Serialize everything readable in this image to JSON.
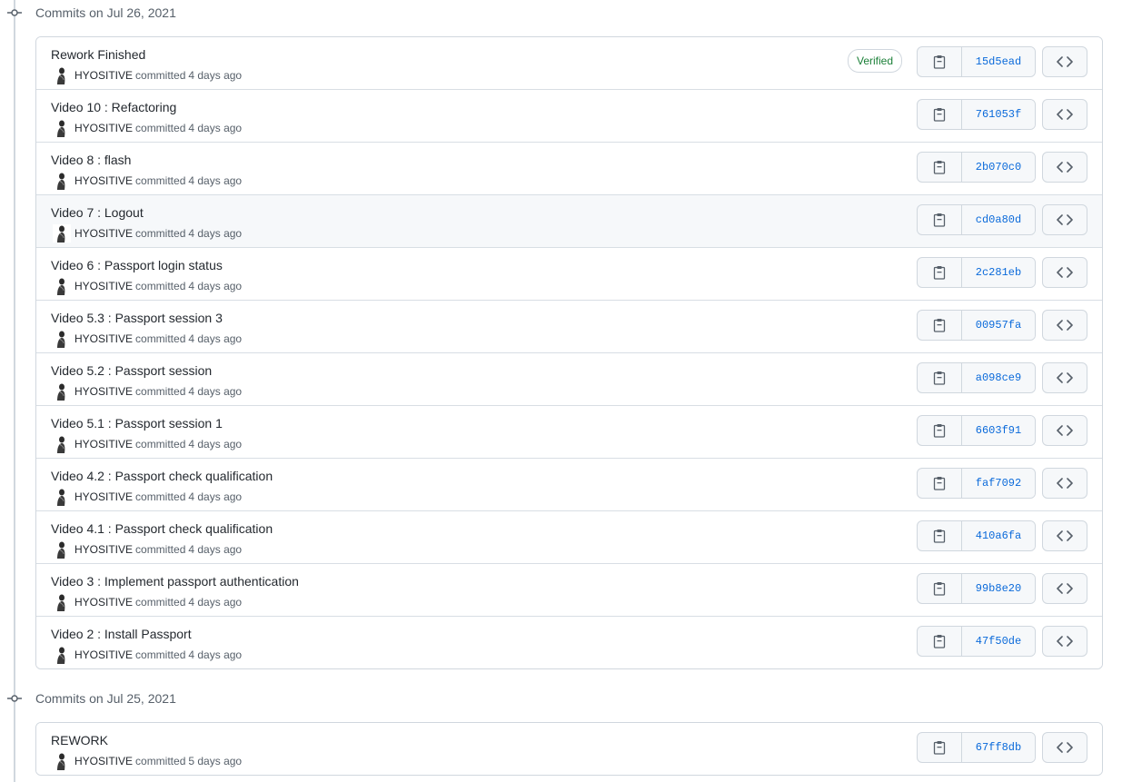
{
  "groups": [
    {
      "title": "Commits on Jul 26, 2021",
      "commits": [
        {
          "message": "Rework Finished",
          "author": "HYOSITIVE",
          "action": "committed",
          "time": "4 days ago",
          "verified": "Verified",
          "sha": "15d5ead"
        },
        {
          "message": "Video 10 : Refactoring",
          "author": "HYOSITIVE",
          "action": "committed",
          "time": "4 days ago",
          "sha": "761053f"
        },
        {
          "message": "Video 8 : flash",
          "author": "HYOSITIVE",
          "action": "committed",
          "time": "4 days ago",
          "sha": "2b070c0"
        },
        {
          "message": "Video 7 : Logout",
          "author": "HYOSITIVE",
          "action": "committed",
          "time": "4 days ago",
          "sha": "cd0a80d"
        },
        {
          "message": "Video 6 : Passport login status",
          "author": "HYOSITIVE",
          "action": "committed",
          "time": "4 days ago",
          "sha": "2c281eb"
        },
        {
          "message": "Video 5.3 : Passport session 3",
          "author": "HYOSITIVE",
          "action": "committed",
          "time": "4 days ago",
          "sha": "00957fa"
        },
        {
          "message": "Video 5.2 : Passport session",
          "author": "HYOSITIVE",
          "action": "committed",
          "time": "4 days ago",
          "sha": "a098ce9"
        },
        {
          "message": "Video 5.1 : Passport session 1",
          "author": "HYOSITIVE",
          "action": "committed",
          "time": "4 days ago",
          "sha": "6603f91"
        },
        {
          "message": "Video 4.2 : Passport check qualification",
          "author": "HYOSITIVE",
          "action": "committed",
          "time": "4 days ago",
          "sha": "faf7092"
        },
        {
          "message": "Video 4.1 : Passport check qualification",
          "author": "HYOSITIVE",
          "action": "committed",
          "time": "4 days ago",
          "sha": "410a6fa"
        },
        {
          "message": "Video 3 : Implement passport authentication",
          "author": "HYOSITIVE",
          "action": "committed",
          "time": "4 days ago",
          "sha": "99b8e20"
        },
        {
          "message": "Video 2 : Install Passport",
          "author": "HYOSITIVE",
          "action": "committed",
          "time": "4 days ago",
          "sha": "47f50de"
        }
      ]
    },
    {
      "title": "Commits on Jul 25, 2021",
      "commits": [
        {
          "message": "REWORK",
          "author": "HYOSITIVE",
          "action": "committed",
          "time": "5 days ago",
          "sha": "67ff8db"
        }
      ]
    }
  ],
  "icons": {
    "commit": "git-commit-icon",
    "copy": "clipboard-icon",
    "browse": "code-icon",
    "avatar": "avatar"
  },
  "colors": {
    "link": "#0969da",
    "verified": "#1a7f37",
    "border": "#d0d7de",
    "muted": "#57606a"
  }
}
